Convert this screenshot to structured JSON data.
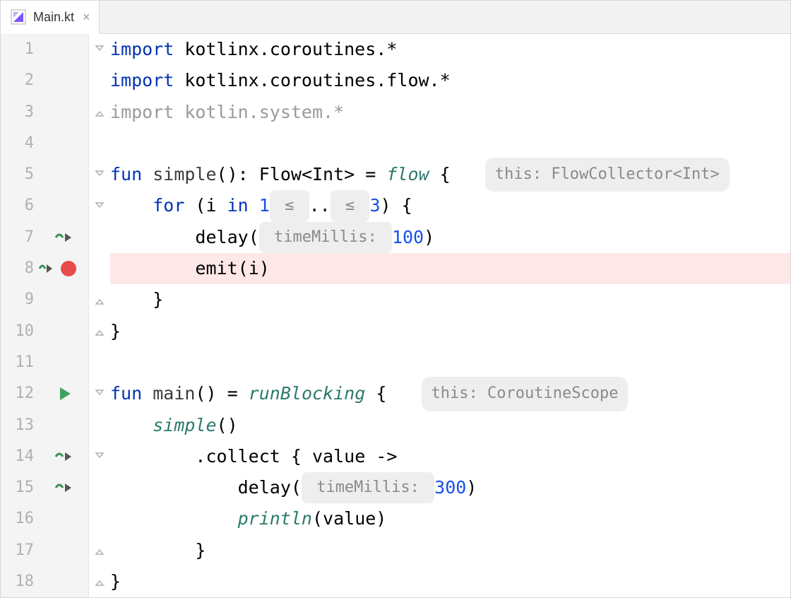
{
  "tab": {
    "filename": "Main.kt"
  },
  "lineNumbers": [
    "1",
    "2",
    "3",
    "4",
    "5",
    "6",
    "7",
    "8",
    "9",
    "10",
    "11",
    "12",
    "13",
    "14",
    "15",
    "16",
    "17",
    "18"
  ],
  "gutterIcons": {
    "7": "suspend",
    "8": "suspend-breakpoint",
    "12": "run",
    "14": "suspend",
    "15": "suspend"
  },
  "code": {
    "l1": {
      "kw": "import",
      "rest": " kotlinx.coroutines.*"
    },
    "l2": {
      "kw": "import",
      "rest": " kotlinx.coroutines.flow.*"
    },
    "l3": {
      "kw": "import",
      "rest": " kotlin.system.*"
    },
    "l5": {
      "kw1": "fun",
      "name": "simple",
      "after": "(): Flow<Int> = ",
      "flow": "flow",
      "brace": " {",
      "hint": "this: FlowCollector<Int>"
    },
    "l6": {
      "kw1": "for",
      "open": " (i ",
      "kw2": "in",
      "sp": " ",
      "n1": "1",
      "r1": " ≤ ",
      "dots": "..",
      "r2": " ≤ ",
      "n2": "3",
      "close": ") {"
    },
    "l7": {
      "fn": "delay",
      "open": "(",
      "hint": " timeMillis: ",
      "n": "100",
      "close": ")"
    },
    "l8": {
      "fn": "emit",
      "args": "(i)"
    },
    "l9": {
      "brace": "}"
    },
    "l10": {
      "brace": "}"
    },
    "l12": {
      "kw1": "fun",
      "name": "main",
      "after": "() = ",
      "rb": "runBlocking",
      "brace": " {",
      "hint": "this: CoroutineScope"
    },
    "l13": {
      "fn": "simple",
      "args": "()"
    },
    "l14": {
      "fn": ".collect",
      "args": " { value ->"
    },
    "l15": {
      "fn": "delay",
      "open": "(",
      "hint": " timeMillis: ",
      "n": "300",
      "close": ")"
    },
    "l16": {
      "fn": "println",
      "args": "(value)"
    },
    "l17": {
      "brace": "}"
    },
    "l18": {
      "brace": "}"
    }
  }
}
